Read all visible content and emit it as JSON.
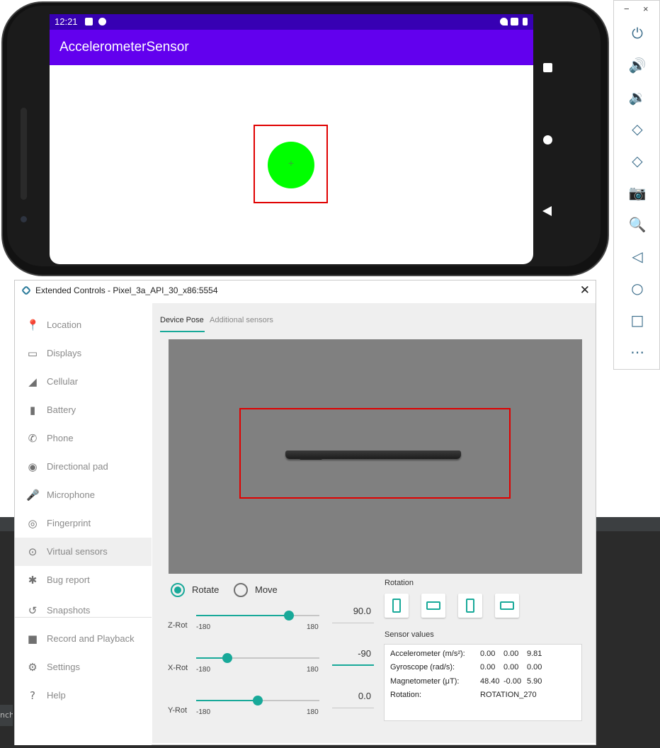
{
  "emulator": {
    "statusbar": {
      "time": "12:21"
    },
    "app_title": "AccelerometerSensor"
  },
  "toolbar": {
    "minimize": "−",
    "close": "×",
    "buttons": [
      "power-icon",
      "volume-up-icon",
      "volume-down-icon",
      "rotate-left-icon",
      "rotate-right-icon",
      "camera-icon",
      "zoom-icon",
      "back-icon",
      "home-icon",
      "overview-icon",
      "more-icon"
    ]
  },
  "ide": {
    "tab_text": "nch"
  },
  "extended_controls": {
    "window_title": "Extended Controls - Pixel_3a_API_30_x86:5554",
    "sidebar": [
      {
        "label": "Location",
        "icon": "location-pin-icon"
      },
      {
        "label": "Displays",
        "icon": "display-icon"
      },
      {
        "label": "Cellular",
        "icon": "signal-icon"
      },
      {
        "label": "Battery",
        "icon": "battery-icon"
      },
      {
        "label": "Phone",
        "icon": "phone-icon"
      },
      {
        "label": "Directional pad",
        "icon": "dpad-icon"
      },
      {
        "label": "Microphone",
        "icon": "microphone-icon"
      },
      {
        "label": "Fingerprint",
        "icon": "fingerprint-icon"
      },
      {
        "label": "Virtual sensors",
        "icon": "sensors-icon"
      },
      {
        "label": "Bug report",
        "icon": "bug-icon"
      },
      {
        "label": "Snapshots",
        "icon": "history-icon"
      },
      {
        "label": "Record and Playback",
        "icon": "video-icon"
      },
      {
        "label": "Settings",
        "icon": "gear-icon"
      },
      {
        "label": "Help",
        "icon": "help-icon"
      }
    ],
    "active_item": "Virtual sensors",
    "tabs": {
      "device_pose": "Device Pose",
      "additional_sensors": "Additional sensors"
    },
    "mode": {
      "rotate": "Rotate",
      "move": "Move",
      "selected": "Rotate"
    },
    "sliders": {
      "z": {
        "label": "Z-Rot",
        "min": "-180",
        "max": "180",
        "value": "90.0",
        "position": 0.75
      },
      "x": {
        "label": "X-Rot",
        "min": "-180",
        "max": "180",
        "value": "-90",
        "position": 0.25
      },
      "y": {
        "label": "Y-Rot",
        "min": "-180",
        "max": "180",
        "value": "0.0",
        "position": 0.5
      }
    },
    "rotation_title": "Rotation",
    "sensor_values_title": "Sensor values",
    "sensor_values": {
      "accelerometer": {
        "label": "Accelerometer (m/s²):",
        "v1": "0.00",
        "v2": "0.00",
        "v3": "9.81"
      },
      "gyroscope": {
        "label": "Gyroscope (rad/s):",
        "v1": "0.00",
        "v2": "0.00",
        "v3": "0.00"
      },
      "magnetometer": {
        "label": "Magnetometer (μT):",
        "v1": "48.40",
        "v2": "-0.00",
        "v3": "5.90"
      },
      "rotation": {
        "label": "Rotation:",
        "value": "ROTATION_270"
      }
    }
  },
  "colors": {
    "accent": "#18a999",
    "appbar": "#6200ee",
    "statusbar": "#3700b3",
    "ball": "#00ff00",
    "highlight_box": "#e00000"
  }
}
